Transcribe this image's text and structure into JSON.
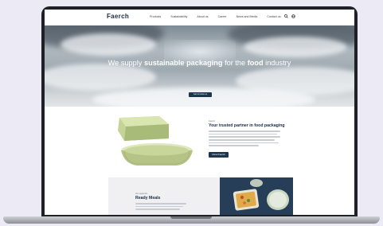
{
  "site": {
    "logo": "Faerch"
  },
  "nav": {
    "links": [
      "Products",
      "Sustainability",
      "About us",
      "Career",
      "News and Media",
      "Contact us"
    ],
    "icons": [
      "search-icon",
      "globe-icon"
    ]
  },
  "hero": {
    "heading_pre": "We supply",
    "heading_strong1": "sustainable packaging",
    "heading_mid": "for the",
    "heading_strong2": "food",
    "heading_post": "industry",
    "cta": "Get to know us"
  },
  "partner": {
    "eyebrow": "Faerch",
    "title": "Your trusted partner in food packaging",
    "button": "About Faerch"
  },
  "meals": {
    "eyebrow": "Our segments",
    "title": "Ready Meals"
  },
  "colors": {
    "brand_navy": "#1e3550",
    "background": "#ecebf5",
    "laptop_frame": "#1f2126"
  }
}
